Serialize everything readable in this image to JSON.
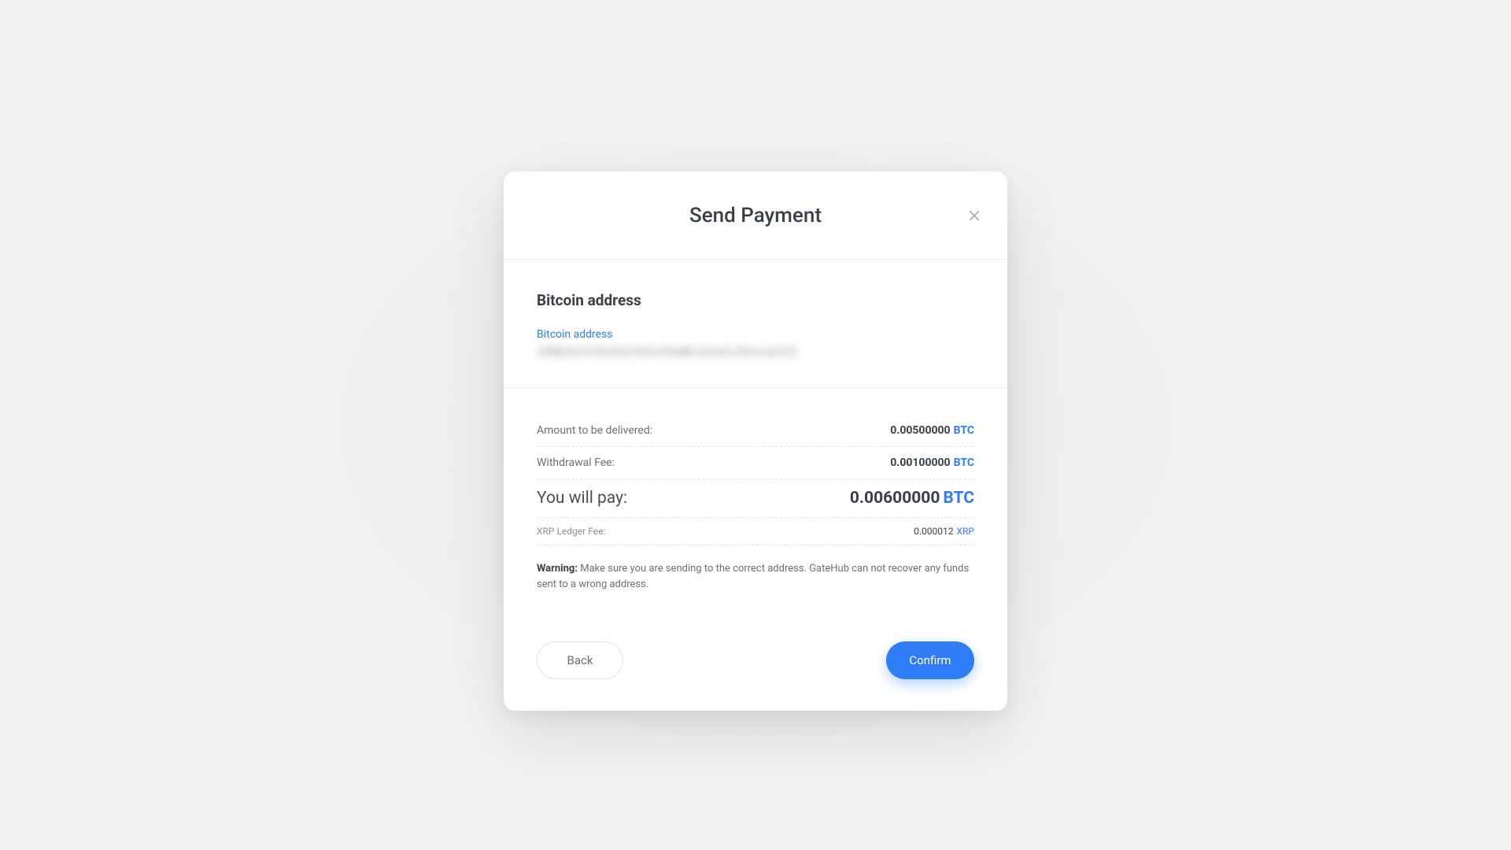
{
  "colors": {
    "accent": "#2e7cf6",
    "text": "#3b4048",
    "muted": "#6a7077"
  },
  "modal": {
    "title": "Send Payment",
    "address_section": {
      "heading": "Bitcoin address",
      "label": "Bitcoin address",
      "value_obscured": "2NBj4zOr3hA0mH0uVbaBLkAwOJftmvanVZ"
    },
    "rows": {
      "amount": {
        "label": "Amount to be delivered:",
        "value": "0.00500000",
        "currency": "BTC"
      },
      "fee": {
        "label": "Withdrawal Fee:",
        "value": "0.00100000",
        "currency": "BTC"
      },
      "total": {
        "label": "You will pay:",
        "value": "0.00600000",
        "currency": "BTC"
      },
      "ledger": {
        "label": "XRP Ledger Fee:",
        "value": "0.000012",
        "currency": "XRP"
      }
    },
    "warning": {
      "prefix": "Warning:",
      "text": "Make sure you are sending to the correct address. GateHub can not recover any funds sent to a wrong address."
    },
    "buttons": {
      "back": "Back",
      "confirm": "Confirm"
    }
  }
}
